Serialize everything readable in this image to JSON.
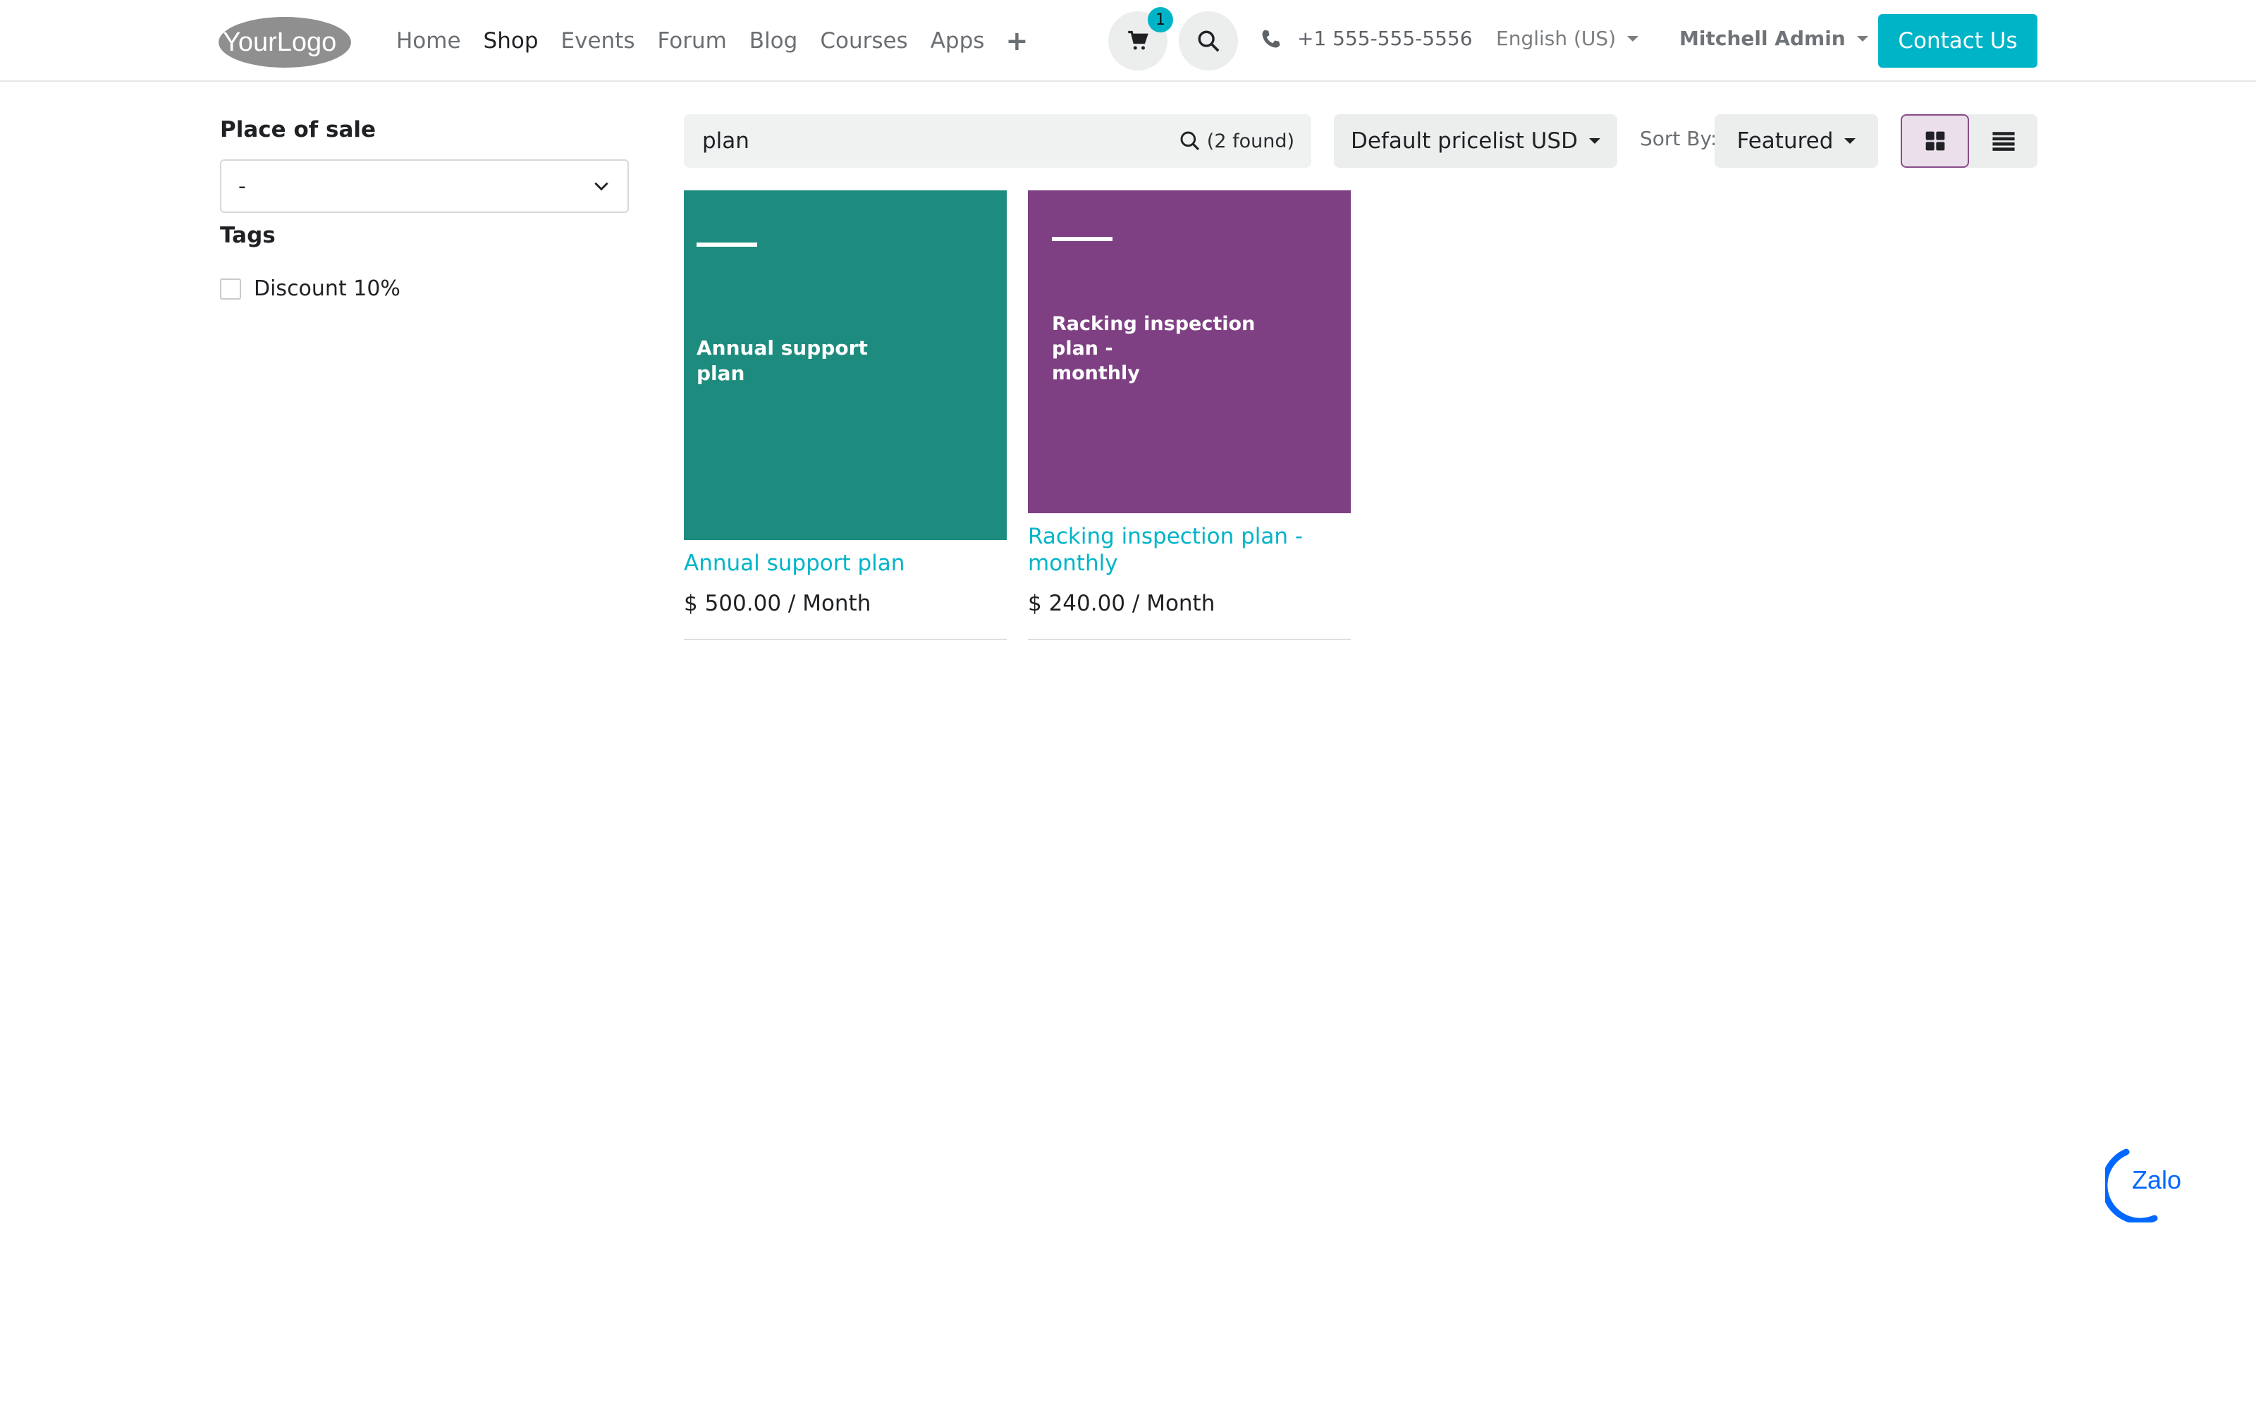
{
  "brand": {
    "logo_text": "YourLogo",
    "accent_color": "#00b4c8"
  },
  "nav": {
    "items": [
      {
        "label": "Home",
        "active": false
      },
      {
        "label": "Shop",
        "active": true
      },
      {
        "label": "Events",
        "active": false
      },
      {
        "label": "Forum",
        "active": false
      },
      {
        "label": "Blog",
        "active": false
      },
      {
        "label": "Courses",
        "active": false
      },
      {
        "label": "Apps",
        "active": false
      }
    ],
    "plus": "+"
  },
  "header": {
    "cart_count": "1",
    "phone": "+1 555-555-5556",
    "language": "English (US)",
    "user": "Mitchell Admin",
    "contact_label": "Contact Us"
  },
  "sidebar": {
    "place_of_sale_title": "Place of sale",
    "place_of_sale_value": "-",
    "tags_title": "Tags",
    "tags": [
      {
        "label": "Discount 10%",
        "checked": false
      }
    ]
  },
  "toolbar": {
    "search_value": "plan",
    "found_text": "(2 found)",
    "pricelist": "Default pricelist USD",
    "sort_label": "Sort By:",
    "sort_value": "Featured",
    "view_mode": "grid"
  },
  "products": [
    {
      "thumb_color": "#1d8c7e",
      "thumb_lines": [
        "Annual support",
        "plan"
      ],
      "name": "Annual support plan",
      "price": "$ 500.00 / Month"
    },
    {
      "thumb_color": "#7e4083",
      "thumb_lines": [
        "Racking inspection",
        "plan -",
        "monthly"
      ],
      "name": "Racking inspection plan - monthly",
      "price": "$ 240.00 / Month"
    }
  ],
  "widgets": {
    "zalo_label": "Zalo"
  }
}
